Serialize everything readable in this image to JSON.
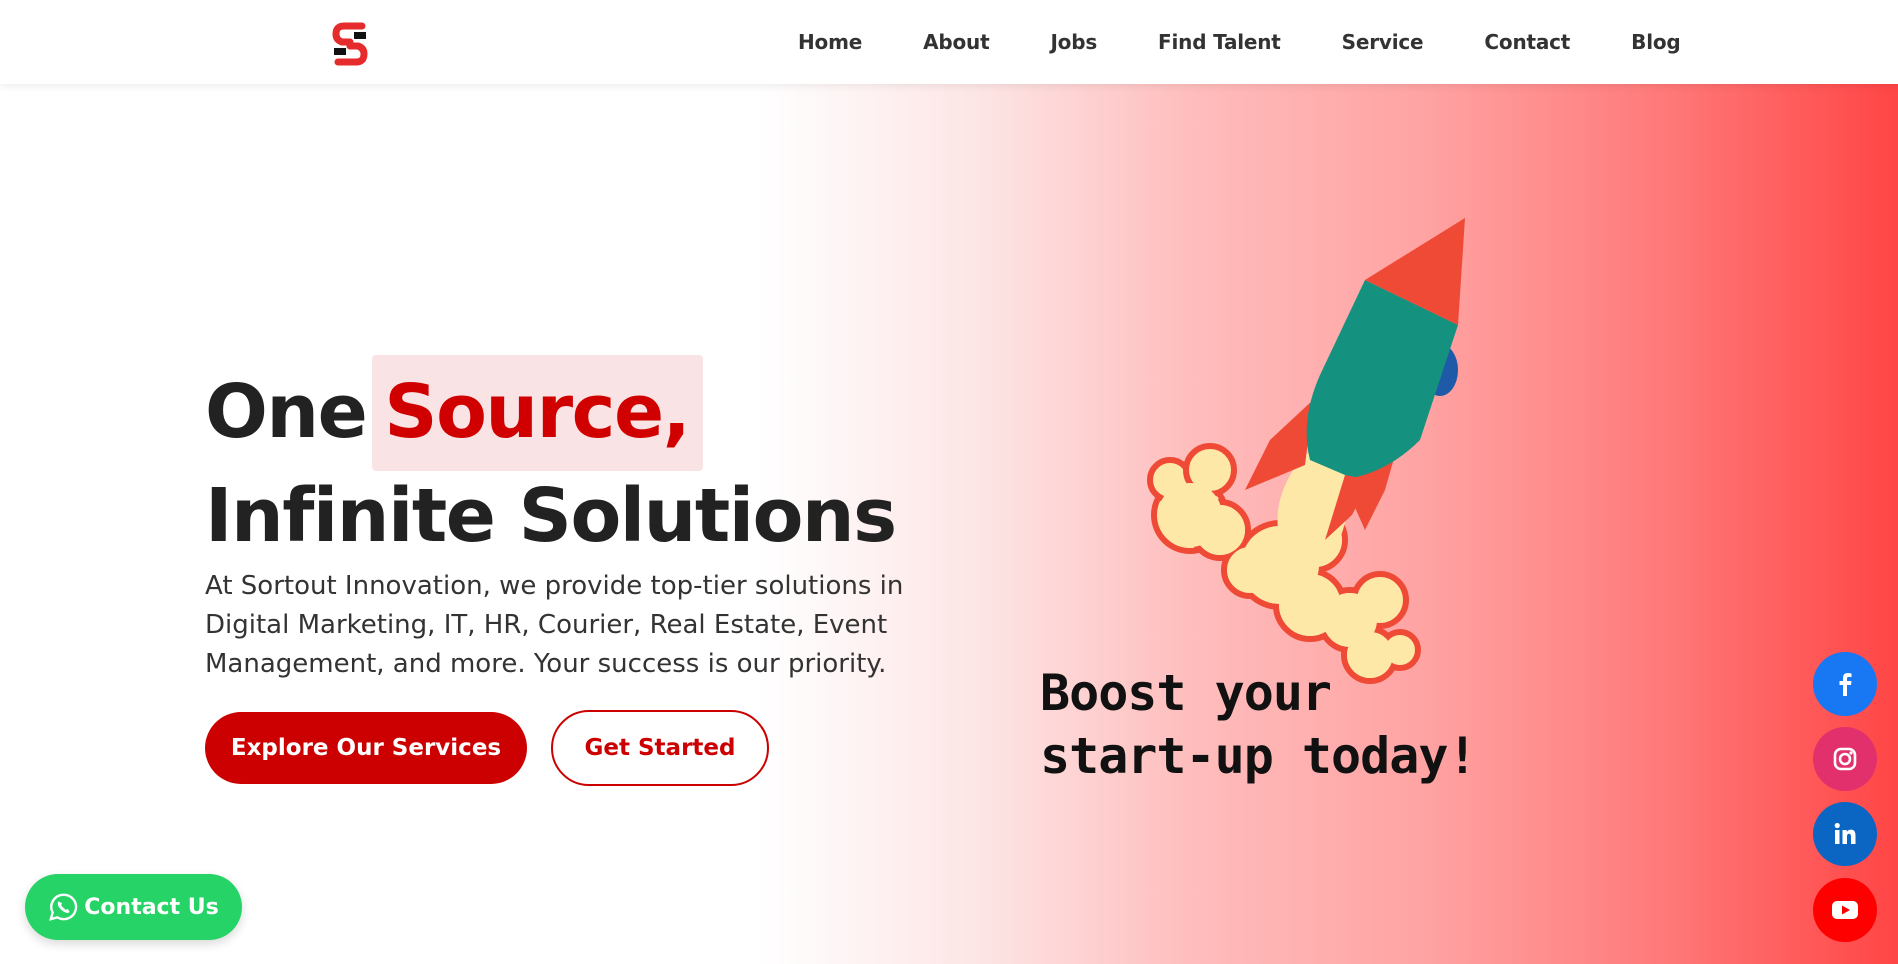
{
  "header": {
    "logo_icon": "sortout-s-logo",
    "nav": [
      "Home",
      "About",
      "Jobs",
      "Find Talent",
      "Service",
      "Contact",
      "Blog"
    ]
  },
  "hero": {
    "headline_prefix": "One",
    "headline_highlight": "Source,",
    "headline_line2": "Infinite Solutions",
    "description": "At Sortout Innovation, we provide top-tier solutions in Digital Marketing, IT, HR, Courier, Real Estate, Event Management, and more. Your success is our priority.",
    "primary_button": "Explore Our Services",
    "secondary_button": "Get Started",
    "illustration_line1": "Boost your",
    "illustration_line2": "start-up today!"
  },
  "whatsapp": {
    "label": "Contact Us",
    "icon": "whatsapp-icon"
  },
  "social": [
    {
      "name": "facebook",
      "icon": "facebook-icon"
    },
    {
      "name": "instagram",
      "icon": "instagram-icon"
    },
    {
      "name": "linkedin",
      "icon": "linkedin-icon"
    },
    {
      "name": "youtube",
      "icon": "youtube-icon"
    }
  ],
  "colors": {
    "brand_red": "#cc0000",
    "highlight_bg": "#f9e3e4",
    "whatsapp_green": "#25d366",
    "facebook": "#1877f2",
    "instagram": "#e1306c",
    "linkedin": "#0a66c2",
    "youtube": "#ff0000"
  }
}
